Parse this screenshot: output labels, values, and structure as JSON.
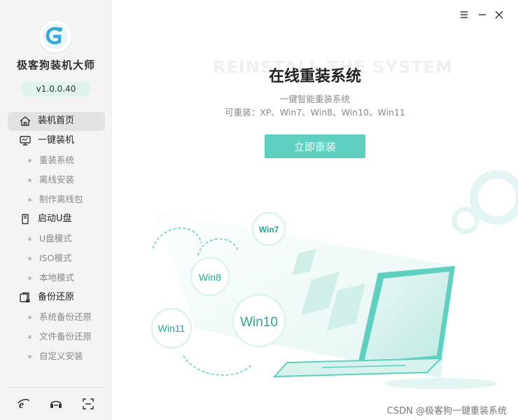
{
  "sidebar": {
    "logo_icon": "greyhound-logo-icon",
    "app_name": "极客狗装机大师",
    "version": "v1.0.0.40",
    "nav": [
      {
        "label": "装机首页",
        "icon": "home-icon",
        "active": true
      },
      {
        "label": "一键装机",
        "icon": "monitor-icon",
        "active": false,
        "children": [
          "重装系统",
          "离线安装",
          "制作离线包"
        ]
      },
      {
        "label": "启动U盘",
        "icon": "usb-drive-icon",
        "active": false,
        "children": [
          "U盘模式",
          "ISO模式",
          "本地模式"
        ]
      },
      {
        "label": "备份还原",
        "icon": "backup-restore-icon",
        "active": false,
        "children": [
          "系统备份还原",
          "文件备份还原",
          "自定义安装"
        ]
      }
    ],
    "footer_icons": [
      "ie-browser-icon",
      "headset-support-icon",
      "fullscreen-icon"
    ]
  },
  "window_controls": [
    "menu-icon",
    "minimize-icon",
    "close-icon"
  ],
  "main": {
    "watermark": "REINSTALL THE SYSTEM",
    "title": "在线重装系统",
    "subtitle": "一键智能重装系统",
    "supported": "可重装：XP、Win7、Win8、Win10、Win11",
    "button_label": "立即重装",
    "bubbles": [
      "Win7",
      "Win8",
      "Win10",
      "Win11"
    ]
  },
  "credit": "CSDN @极客狗一键重装系统",
  "colors": {
    "accent": "#5fcfbf",
    "accent_dark": "#2aa595",
    "sidebar_bg": "#f4f4f4",
    "version_bg": "#dff3ef"
  }
}
